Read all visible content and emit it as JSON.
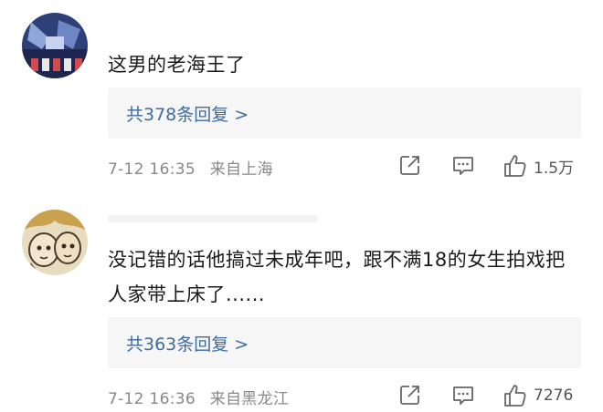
{
  "comments": [
    {
      "text": "这男的老海王了",
      "replies_label": "共378条回复 >",
      "date": "7-12 16:35",
      "location": "来自上海",
      "likes": "1.5万",
      "avatar_icon": "anime-robot-avatar"
    },
    {
      "text": "没记错的话他搞过未成年吧，跟不满18的女生拍戏把人家带上床了......",
      "replies_label": "共363条回复 >",
      "date": "7-12 16:36",
      "location": "来自黑龙江",
      "likes": "7276",
      "avatar_icon": "anime-character-avatar"
    }
  ],
  "icons": {
    "share": "share-icon",
    "comment": "comment-icon",
    "like": "thumbs-up-icon"
  },
  "colors": {
    "link": "#3f6b9f",
    "meta": "#888888",
    "reply_bg": "#f6f6f6"
  }
}
